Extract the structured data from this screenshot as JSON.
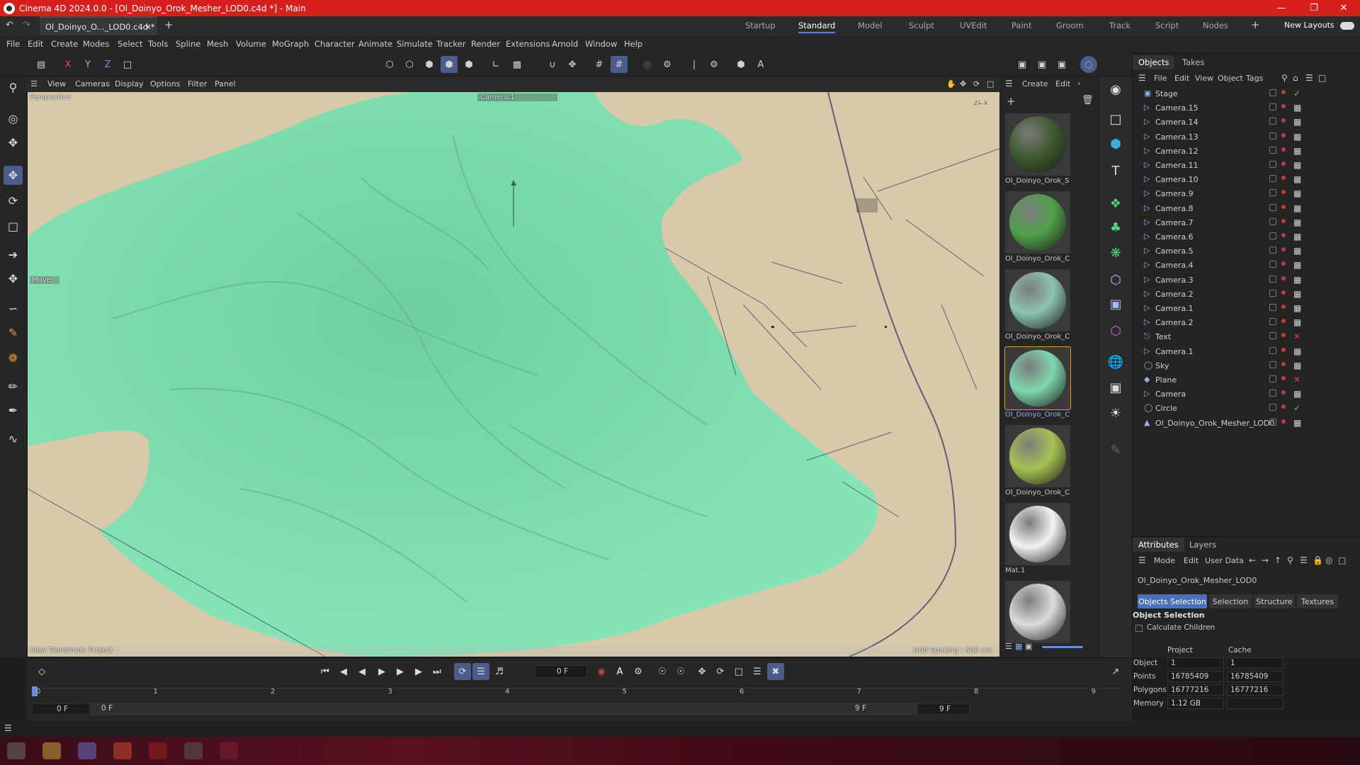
{
  "window": {
    "title": "Cinema 4D 2024.0.0 - [Ol_Doinyo_Orok_Mesher_LOD0.c4d *] - Main"
  },
  "tabs": {
    "file_tab": "Ol_Doinyo_O..._LOD0.c4d *",
    "layouts": [
      "Startup",
      "Standard",
      "Model",
      "Sculpt",
      "UVEdit",
      "Paint",
      "Groom",
      "Track",
      "Script",
      "Nodes"
    ],
    "active_layout": "Standard",
    "new_layouts": "New Layouts"
  },
  "menu": [
    "File",
    "Edit",
    "Create",
    "Modes",
    "Select",
    "Tools",
    "Spline",
    "Mesh",
    "Volume",
    "MoGraph",
    "Character",
    "Animate",
    "Simulate",
    "Tracker",
    "Render",
    "Extensions",
    "Arnold",
    "Window",
    "Help"
  ],
  "axis": {
    "x": "X",
    "y": "Y",
    "z": "Z"
  },
  "viewport": {
    "menu": [
      "View",
      "Cameras",
      "Display",
      "Options",
      "Filter",
      "Panel"
    ],
    "label": "Perspective",
    "camera": "Camera.1",
    "move_label": "Move",
    "view_transform": "View Transform: Project",
    "grid_spacing": "Grid Spacing : 500 cm"
  },
  "materials": {
    "menu": [
      "Create",
      "Edit"
    ],
    "items": [
      {
        "name": "Ol_Doinyo_Orok_S",
        "color": "#3e5a2e"
      },
      {
        "name": "Ol_Doinyo_Orok_C",
        "color": "#4fa04a"
      },
      {
        "name": "Ol_Doinyo_Orok_C",
        "color": "#8cc4b0"
      },
      {
        "name": "Ol_Doinyo_Orok_C",
        "color": "#7fd6ae"
      },
      {
        "name": "Ol_Doinyo_Orok_C",
        "color": "#a6c252"
      },
      {
        "name": "Mat.1",
        "color": "#f2f2f2"
      },
      {
        "name": "",
        "color": "#dcdcdc"
      }
    ]
  },
  "objects": {
    "tabs": [
      "Objects",
      "Takes"
    ],
    "menu": [
      "File",
      "Edit",
      "View",
      "Object",
      "Tags"
    ],
    "items": [
      "Stage",
      "Camera.15",
      "Camera.14",
      "Camera.13",
      "Camera.12",
      "Camera.11",
      "Camera.10",
      "Camera.9",
      "Camera.8",
      "Camera.7",
      "Camera.6",
      "Camera.5",
      "Camera.4",
      "Camera.3",
      "Camera.2",
      "Camera.1",
      "Camera.2",
      "Text",
      "Camera.1",
      "Sky",
      "Plane",
      "Camera",
      "Circle",
      "Ol_Doinyo_Orok_Mesher_LOD0"
    ]
  },
  "attributes": {
    "tabs": [
      "Attributes",
      "Layers"
    ],
    "menu": [
      "Mode",
      "Edit",
      "User Data"
    ],
    "object_name": "Ol_Doinyo_Orok_Mesher_LOD0",
    "buttons": [
      "Objects Selection",
      "Selection",
      "Structure",
      "Textures"
    ],
    "section": "Object Selection",
    "calculate_children": "Calculate Children",
    "col_project": "Project",
    "col_cache": "Cache",
    "rows": [
      {
        "label": "Object",
        "project": "1",
        "cache": "1"
      },
      {
        "label": "Points",
        "project": "16785409",
        "cache": "16785409"
      },
      {
        "label": "Polygons",
        "project": "16777216",
        "cache": "16777216"
      },
      {
        "label": "Memory",
        "project": "1.12 GB",
        "cache": ""
      }
    ]
  },
  "timeline": {
    "frame_field": "0 F",
    "ticks": [
      "0",
      "1",
      "2",
      "3",
      "4",
      "5",
      "6",
      "7",
      "8",
      "9"
    ],
    "range_start": "0 F",
    "range_start2": "0 F",
    "range_end": "9 F",
    "range_end2": "9 F"
  },
  "colors": {
    "titlebar": "#d7201d",
    "accent": "#4b5d8c",
    "selected": "#4b6fb8",
    "mesh": "#86e3b6",
    "terrain": "#d8c9aa"
  }
}
